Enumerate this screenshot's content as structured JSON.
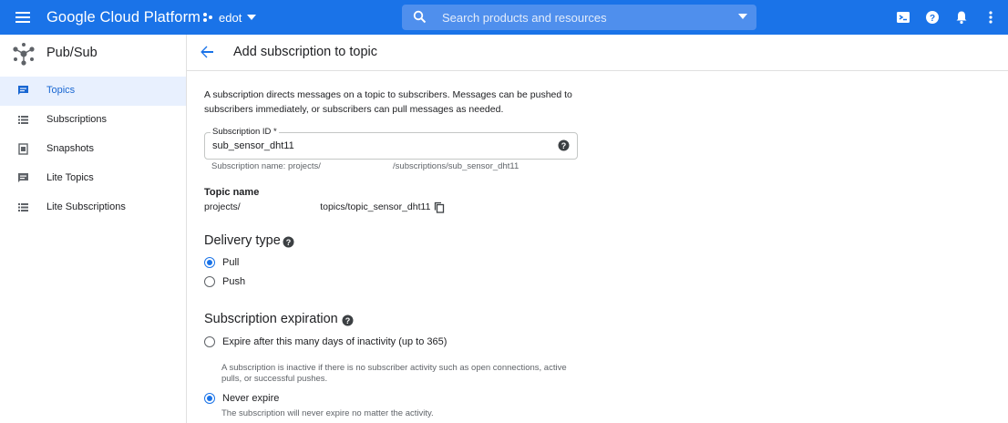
{
  "topbar": {
    "brand": "Google Cloud Platform",
    "project": "edot",
    "search_placeholder": "Search products and resources",
    "icons": [
      "menu-icon",
      "project-dots-icon",
      "search-icon",
      "cloud-shell-icon",
      "help-icon",
      "notifications-icon",
      "more-vert-icon"
    ],
    "color": "#1a73e8"
  },
  "sidebar": {
    "product": "Pub/Sub",
    "items": [
      {
        "label": "Topics",
        "icon": "topics-icon",
        "active": true
      },
      {
        "label": "Subscriptions",
        "icon": "list-icon",
        "active": false
      },
      {
        "label": "Snapshots",
        "icon": "snapshot-icon",
        "active": false
      },
      {
        "label": "Lite Topics",
        "icon": "topics-icon",
        "active": false
      },
      {
        "label": "Lite Subscriptions",
        "icon": "list-icon",
        "active": false
      }
    ]
  },
  "page": {
    "title": "Add subscription to topic",
    "description": "A subscription directs messages on a topic to subscribers. Messages can be pushed to subscribers immediately, or subscribers can pull messages as needed.",
    "subscription_id": {
      "label": "Subscription ID *",
      "value": "sub_sensor_dht11",
      "hint": "Subscription name: projects/                              /subscriptions/sub_sensor_dht11"
    },
    "topic": {
      "label": "Topic name",
      "value": "projects/                              topics/topic_sensor_dht11"
    },
    "delivery": {
      "title": "Delivery type",
      "options": [
        {
          "label": "Pull",
          "checked": true
        },
        {
          "label": "Push",
          "checked": false
        }
      ]
    },
    "expiration": {
      "title": "Subscription expiration",
      "options": [
        {
          "label": "Expire after this many days of inactivity (up to 365)",
          "checked": false,
          "note": "A subscription is inactive if there is no subscriber activity such as open connections, active pulls, or successful pushes."
        },
        {
          "label": "Never expire",
          "checked": true,
          "note": "The subscription will never expire no matter the activity."
        }
      ]
    }
  }
}
